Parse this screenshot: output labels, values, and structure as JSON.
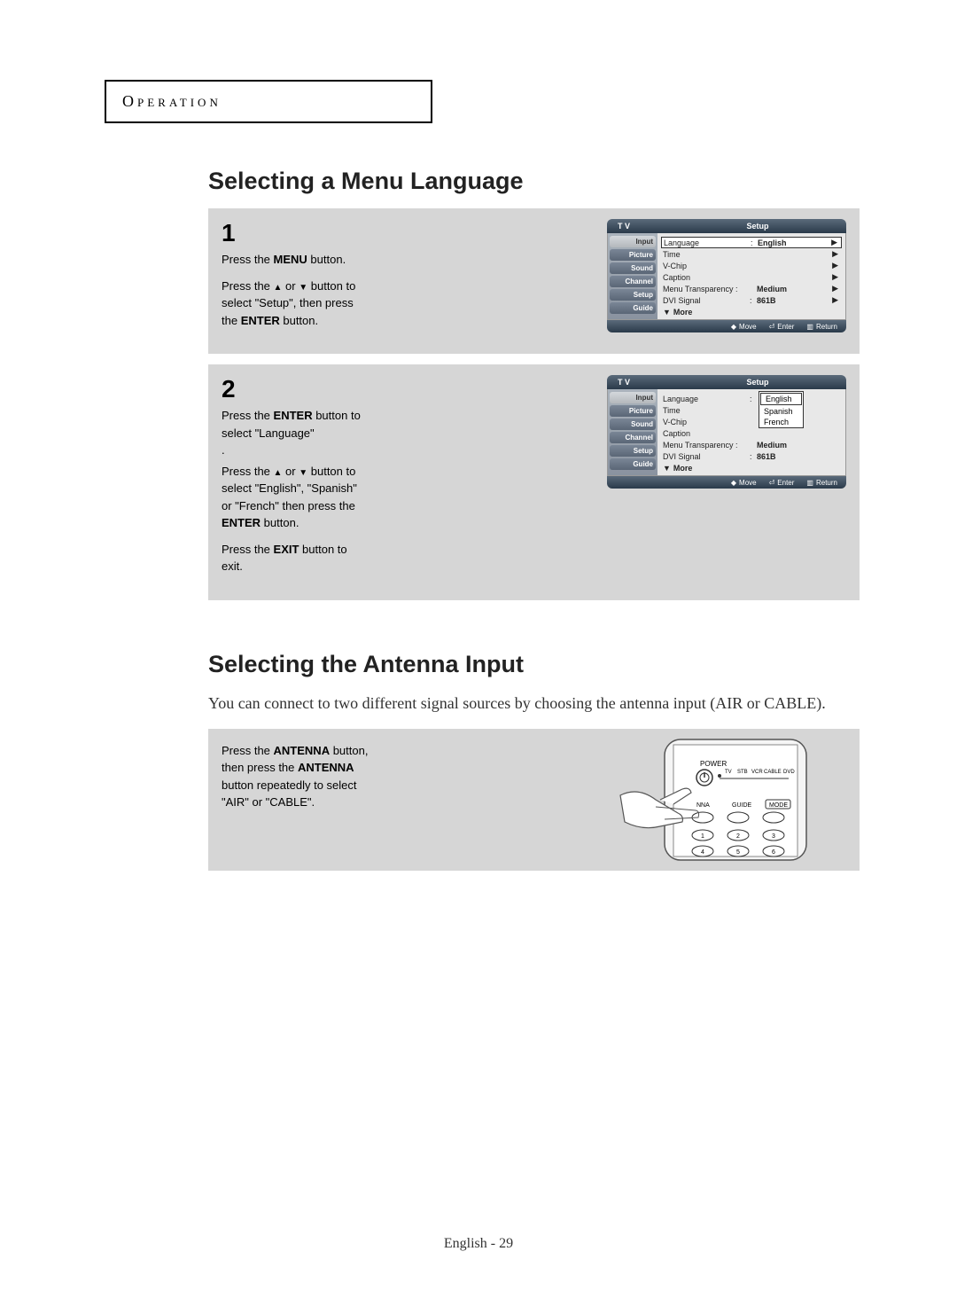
{
  "header": "Operation",
  "section1": {
    "heading": "Selecting a Menu Language",
    "step1": {
      "num": "1",
      "p1_a": "Press the ",
      "p1_b": "MENU",
      "p1_c": " button.",
      "p2_a": "Press the ",
      "p2_b": " or ",
      "p2_c": " button to select \"Setup\", then press the ",
      "p2_d": "ENTER",
      "p2_e": " button."
    },
    "step2": {
      "num": "2",
      "p1_a": "Press the ",
      "p1_b": "ENTER",
      "p1_c": "  button  to select \"Language\"",
      "p1_d": ".",
      "p2_a": "Press the ",
      "p2_b": " or ",
      "p2_c": " button to select \"English\", \"Spanish\" or \"French\" then press the ",
      "p2_d": "ENTER",
      "p2_e": " button.",
      "p3_a": "Press the ",
      "p3_b": "EXIT",
      "p3_c": " button to exit."
    }
  },
  "osd": {
    "title_left": "T V",
    "title_right": "Setup",
    "side": [
      "Input",
      "Picture",
      "Sound",
      "Channel",
      "Setup",
      "Guide"
    ],
    "rows": [
      {
        "label": "Language",
        "value": "English",
        "arrow": true
      },
      {
        "label": "Time",
        "value": "",
        "arrow": true
      },
      {
        "label": "V-Chip",
        "value": "",
        "arrow": true
      },
      {
        "label": "Caption",
        "value": "",
        "arrow": true
      },
      {
        "label": "Menu Transparency :",
        "value": "Medium",
        "arrow": true,
        "nosep": true
      },
      {
        "label": "DVI Signal",
        "value": "861B",
        "arrow": true
      }
    ],
    "more": "More",
    "footer": {
      "move": "Move",
      "enter": "Enter",
      "return": "Return"
    },
    "langs": [
      "English",
      "Spanish",
      "French"
    ]
  },
  "section2": {
    "heading": "Selecting the Antenna Input",
    "body": "You can connect to two different signal sources by choosing the antenna input (AIR or CABLE).",
    "text_a": "Press the ",
    "text_b": "ANTENNA",
    "text_c": " button, then press the ",
    "text_d": "ANTENNA",
    "text_e": " button repeatedly to select \"AIR\" or \"CABLE\"."
  },
  "remote": {
    "power": "POWER",
    "modes": [
      "TV",
      "STB",
      "VCR",
      "CABLE",
      "DVD"
    ],
    "row2": [
      "NNA",
      "GUIDE",
      "MODE"
    ],
    "nums1": [
      "1",
      "2",
      "3"
    ],
    "nums2": [
      "4",
      "5",
      "6"
    ]
  },
  "footer": "English - 29"
}
